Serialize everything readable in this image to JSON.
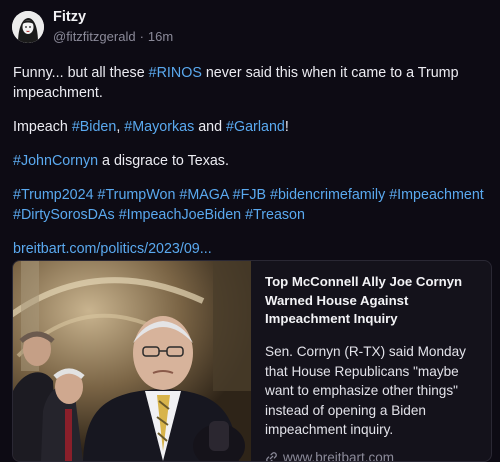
{
  "author": {
    "name": "Fitzy",
    "handle": "@fitzfitzgerald",
    "separator": "·",
    "time": "16m"
  },
  "post": {
    "p1": {
      "t1": "Funny... but all these ",
      "tag1": "#RINOS",
      "t2": " never said this when it came to a Trump impeachment."
    },
    "p2": {
      "t1": "Impeach ",
      "tag1": "#Biden",
      "t2": ", ",
      "tag2": "#Mayorkas",
      "t3": " and ",
      "tag3": "#Garland",
      "t4": "!"
    },
    "p3": {
      "tag1": "#JohnCornyn",
      "t1": " a disgrace to Texas."
    },
    "hashtags": [
      "#Trump2024",
      "#TrumpWon",
      "#MAGA",
      "#FJB",
      "#bidencrimefamily",
      "#Impeachment",
      "#DirtySorosDAs",
      "#ImpeachJoeBiden",
      "#Treason"
    ],
    "link": "breitbart.com/politics/2023/09..."
  },
  "card": {
    "title": "Top McConnell Ally Joe Cornyn Warned House Against Impeachment Inquiry",
    "description": "Sen. Cornyn (R-TX) said Monday that House Republicans \"maybe want to emphasize other things\" instead of opening a Biden impeachment inquiry.",
    "domain": "www.breitbart.com"
  },
  "colors": {
    "background": "#0d0b14",
    "hashtag": "#5aa9ef",
    "muted": "#8b8a99"
  },
  "icons": {
    "link": "link-icon"
  }
}
